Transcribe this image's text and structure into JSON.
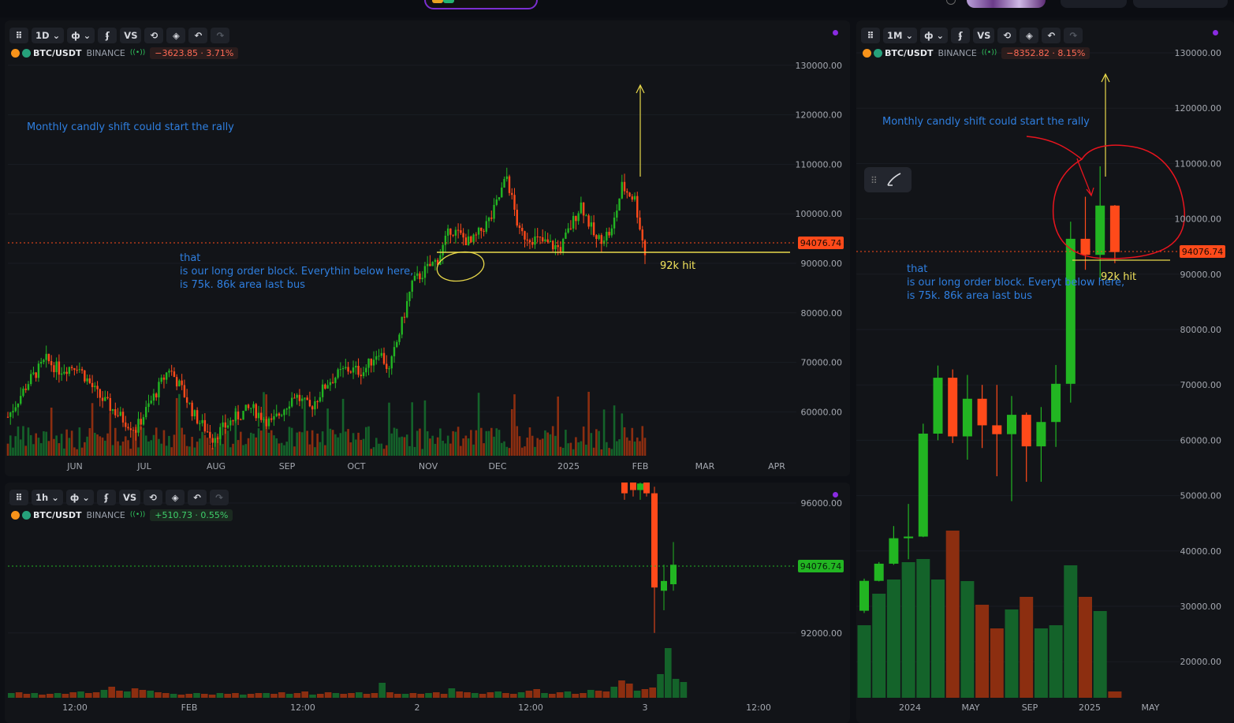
{
  "colors": {
    "up": "#22b522",
    "down": "#ff4a1a",
    "vol_up": "#14632a",
    "vol_down": "#8c2e10",
    "accent": "#7b2fd0"
  },
  "chart_data": [
    {
      "type": "candlestick",
      "id": "daily",
      "interval": "1D",
      "symbol": "BTC/USDT",
      "exchange": "BINANCE",
      "change": "−3623.85 · 3.71%",
      "last_price_label": "94076.74",
      "y_ticks": [
        "130000.00",
        "120000.00",
        "110000.00",
        "100000.00",
        "90000.00",
        "80000.00",
        "70000.00",
        "60000.00"
      ],
      "x_ticks": [
        "JUN",
        "JUL",
        "AUG",
        "SEP",
        "OCT",
        "NOV",
        "DEC",
        "2025",
        "FEB",
        "MAR",
        "APR"
      ],
      "annotations": {
        "top_note": "Monthly candly shift could start the rally",
        "ob_line1": "that",
        "ob_line2": "is our long order block. Everythin below here,",
        "ob_line3": "is 75k.   86k area last bus",
        "hit": "92k hit"
      },
      "waypoints": [
        [
          0,
          59000
        ],
        [
          8,
          66000
        ],
        [
          15,
          70500
        ],
        [
          20,
          68500
        ],
        [
          27,
          69500
        ],
        [
          35,
          63500
        ],
        [
          45,
          58500
        ],
        [
          50,
          56500
        ],
        [
          58,
          64000
        ],
        [
          63,
          68800
        ],
        [
          68,
          64500
        ],
        [
          73,
          59200
        ],
        [
          80,
          54800
        ],
        [
          88,
          58500
        ],
        [
          95,
          60800
        ],
        [
          103,
          57600
        ],
        [
          112,
          63500
        ],
        [
          118,
          60700
        ],
        [
          125,
          66000
        ],
        [
          132,
          68600
        ],
        [
          139,
          68200
        ],
        [
          145,
          72500
        ],
        [
          149,
          68200
        ],
        [
          153,
          76000
        ],
        [
          158,
          86000
        ],
        [
          163,
          88500
        ],
        [
          168,
          90800
        ],
        [
          173,
          97000
        ],
        [
          181,
          94000
        ],
        [
          189,
          99300
        ],
        [
          195,
          107500
        ],
        [
          200,
          96000
        ],
        [
          208,
          94500
        ],
        [
          216,
          93000
        ],
        [
          224,
          102000
        ],
        [
          230,
          94500
        ],
        [
          236,
          96500
        ],
        [
          240,
          105500
        ],
        [
          245,
          103000
        ],
        [
          249,
          92000
        ]
      ],
      "n_candles": 250
    },
    {
      "type": "candlestick",
      "id": "hourly",
      "interval": "1h",
      "symbol": "BTC/USDT",
      "exchange": "BINANCE",
      "change": "+510.73 · 0.55%",
      "last_price_label": "94076.74",
      "y_ticks": [
        "96000.00",
        "92000.00"
      ],
      "x_ticks": [
        "12:00",
        "FEB",
        "12:00",
        "2",
        "12:00",
        "3",
        "12:00"
      ]
    },
    {
      "type": "candlestick",
      "id": "monthly",
      "interval": "1M",
      "symbol": "BTC/USDT",
      "exchange": "BINANCE",
      "change": "−8352.82 · 8.15%",
      "last_price_label": "94076.74",
      "y_ticks": [
        "130000.00",
        "120000.00",
        "110000.00",
        "100000.00",
        "90000.00",
        "80000.00",
        "70000.00",
        "60000.00",
        "50000.00",
        "40000.00",
        "30000.00",
        "20000.00"
      ],
      "x_ticks": [
        "2024",
        "MAY",
        "SEP",
        "2025",
        "MAY"
      ],
      "annotations": {
        "top_note": "Monthly candly shift could start the rally",
        "ob_line1": "that",
        "ob_line2": "is our long order block. Everyt     below here,",
        "ob_line3": "is 75k.   86k area last bus",
        "hit": "92k hit"
      },
      "candles": [
        {
          "o": 29200,
          "h": 35000,
          "l": 28800,
          "c": 34600
        },
        {
          "o": 34600,
          "h": 38000,
          "l": 34500,
          "c": 37700
        },
        {
          "o": 37700,
          "h": 44500,
          "l": 37500,
          "c": 42300
        },
        {
          "o": 42300,
          "h": 48500,
          "l": 38500,
          "c": 42600
        },
        {
          "o": 42600,
          "h": 63000,
          "l": 42500,
          "c": 61200
        },
        {
          "o": 61200,
          "h": 73500,
          "l": 60000,
          "c": 71300
        },
        {
          "o": 71300,
          "h": 72800,
          "l": 59500,
          "c": 60700
        },
        {
          "o": 60700,
          "h": 71800,
          "l": 56500,
          "c": 67500
        },
        {
          "o": 67500,
          "h": 70000,
          "l": 58600,
          "c": 62700
        },
        {
          "o": 62700,
          "h": 70000,
          "l": 53500,
          "c": 61100
        },
        {
          "o": 61100,
          "h": 68000,
          "l": 49000,
          "c": 64600
        },
        {
          "o": 64600,
          "h": 65000,
          "l": 52500,
          "c": 58900
        },
        {
          "o": 58900,
          "h": 66000,
          "l": 52500,
          "c": 63300
        },
        {
          "o": 63300,
          "h": 73600,
          "l": 58800,
          "c": 70200
        },
        {
          "o": 70200,
          "h": 99500,
          "l": 66800,
          "c": 96400
        },
        {
          "o": 96400,
          "h": 104000,
          "l": 90800,
          "c": 93500
        },
        {
          "o": 93500,
          "h": 109500,
          "l": 89200,
          "c": 102400
        },
        {
          "o": 102400,
          "h": 102500,
          "l": 92000,
          "c": 94000
        }
      ]
    }
  ]
}
